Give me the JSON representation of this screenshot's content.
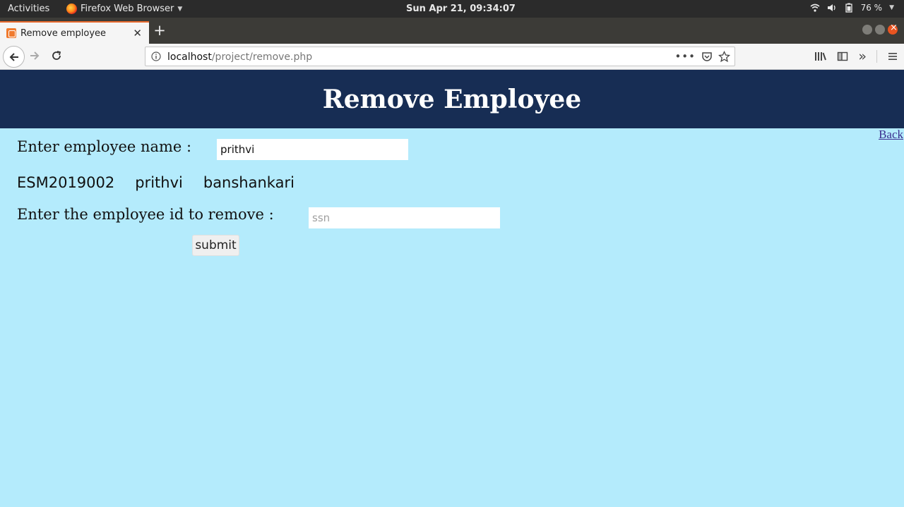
{
  "system_bar": {
    "activities": "Activities",
    "app_name": "Firefox Web Browser",
    "clock": "Sun Apr 21, 09:34:07",
    "battery": "76 %"
  },
  "browser": {
    "tab_title": "Remove employee",
    "url_host": "localhost",
    "url_path": "/project/remove.php"
  },
  "page": {
    "title": "Remove Employee",
    "back_link": "Back",
    "name_label": "Enter employee name :",
    "name_value": "prithvi",
    "record": {
      "id": "ESM2019002",
      "name": "prithvi",
      "address": "banshankari"
    },
    "remove_label": "Enter the employee id to remove :",
    "remove_placeholder": "ssn",
    "submit_label": "submit"
  },
  "colors": {
    "header_bg": "#172d54",
    "page_bg": "#b4ebfc",
    "tab_accent": "#e86a2e"
  }
}
